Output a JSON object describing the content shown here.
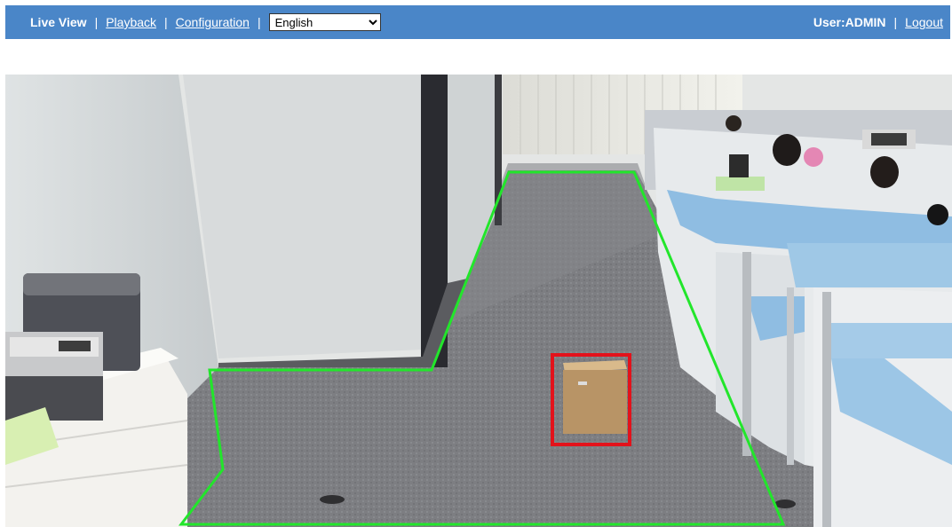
{
  "nav": {
    "live_view": "Live View",
    "playback": "Playback",
    "configuration": "Configuration",
    "separator": "|",
    "language_select": {
      "selected": "English",
      "options": [
        "English"
      ]
    }
  },
  "user": {
    "label": "User:ADMIN",
    "logout": "Logout"
  },
  "video": {
    "detection_zone": {
      "color": "#22e62b",
      "shape": "polygon"
    },
    "detected_object": {
      "color": "#e3121b",
      "label": "cardboard box"
    }
  },
  "colors": {
    "topbar": "#4a86c8",
    "zone_outline": "#22e62b",
    "object_box": "#e3121b"
  }
}
